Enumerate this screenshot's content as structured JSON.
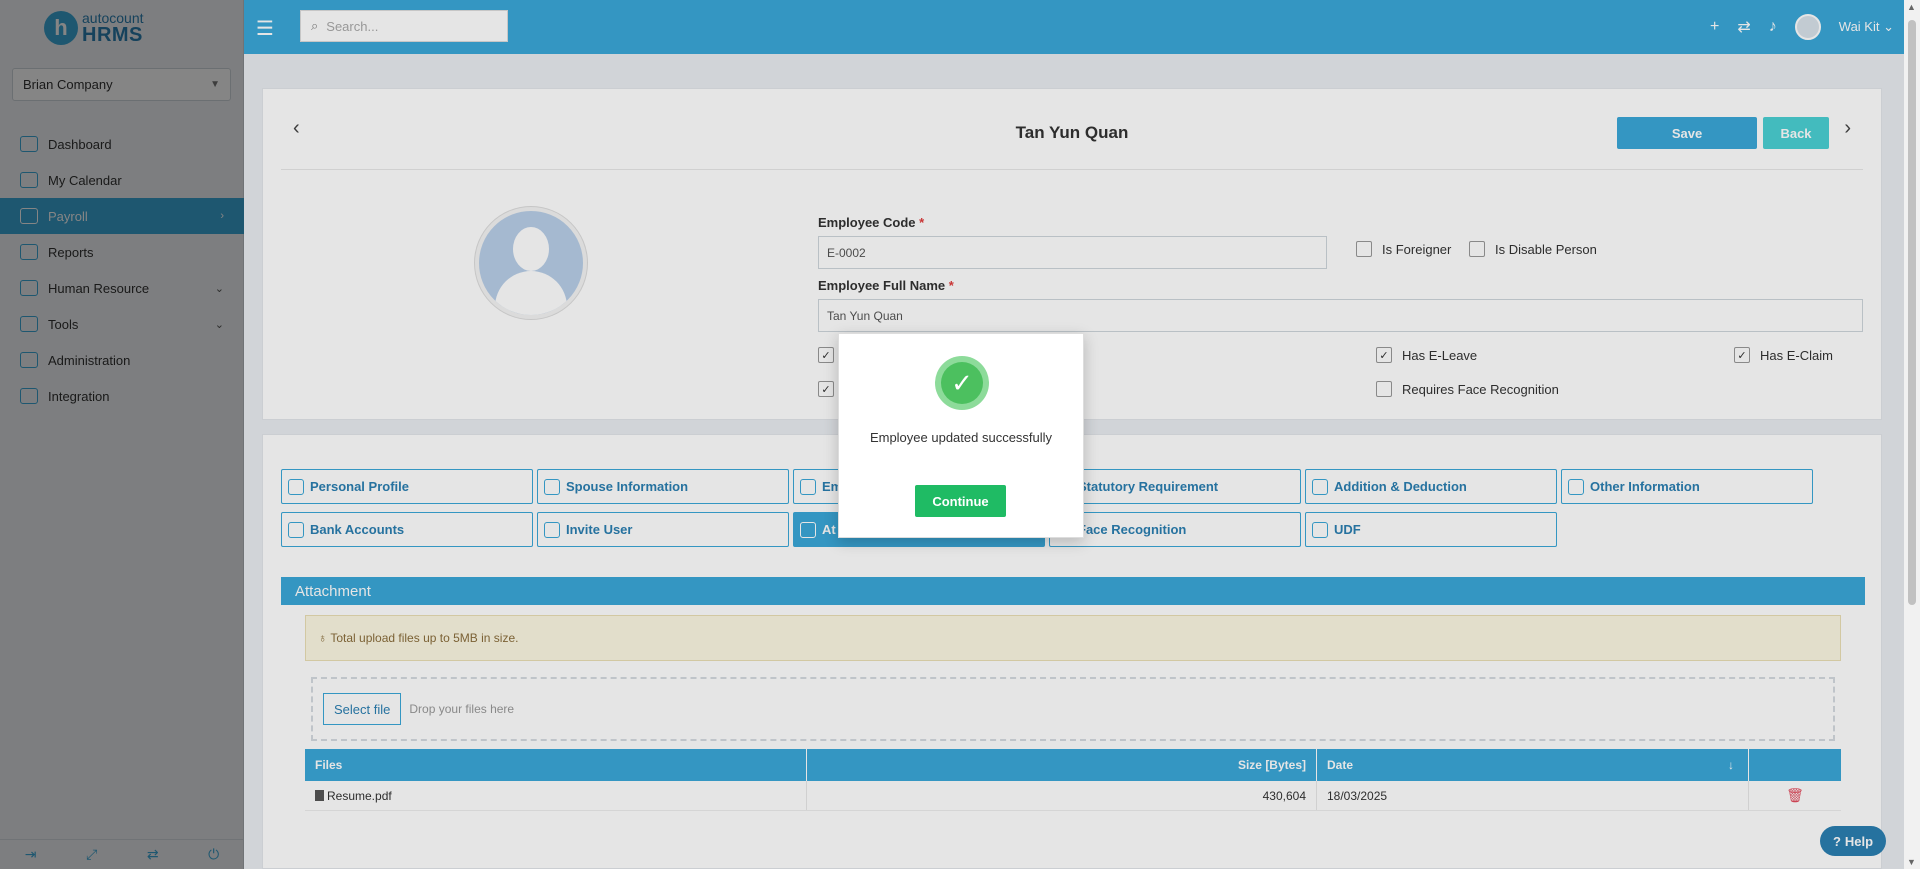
{
  "brand": {
    "logo_letter": "h",
    "logo_top": "autocount",
    "logo_bottom": "HRMS"
  },
  "company": {
    "selected": "Brian Company"
  },
  "sidebar": {
    "items": [
      {
        "label": "Dashboard",
        "icon": "dashboard-icon"
      },
      {
        "label": "My Calendar",
        "icon": "calendar-icon"
      },
      {
        "label": "Payroll",
        "icon": "payroll-icon",
        "active": true,
        "arrow": "›"
      },
      {
        "label": "Reports",
        "icon": "reports-icon"
      },
      {
        "label": "Human Resource",
        "icon": "human-resource-icon",
        "arrow": "⌄"
      },
      {
        "label": "Tools",
        "icon": "tools-icon",
        "arrow": "⌄"
      },
      {
        "label": "Administration",
        "icon": "administration-icon"
      },
      {
        "label": "Integration",
        "icon": "integration-icon"
      }
    ]
  },
  "topbar": {
    "search_placeholder": "Search...",
    "user_name": "Wai Kit"
  },
  "employee": {
    "title": "Tan Yun Quan",
    "save_label": "Save",
    "back_label": "Back",
    "code_label": "Employee Code",
    "code_value": "E-0002",
    "fullname_label": "Employee Full Name",
    "fullname_value": "Tan Yun Quan",
    "required_mark": "*",
    "is_foreigner": "Is Foreigner",
    "is_disable": "Is Disable Person",
    "has_eleave": "Has E-Leave",
    "has_eclaim": "Has E-Claim",
    "requires_face": "Requires Face Recognition"
  },
  "tabs": {
    "personal_profile": "Personal Profile",
    "spouse_information": "Spouse Information",
    "employment_partial": "Em",
    "statutory_requirement": "Statutory Requirement",
    "addition_deduction": "Addition & Deduction",
    "other_information": "Other Information",
    "bank_accounts": "Bank Accounts",
    "invite_user": "Invite User",
    "attachment_partial": "At",
    "face_recognition": "Face Recognition",
    "udf": "UDF"
  },
  "attachment": {
    "header": "Attachment",
    "info": "Total upload files up to 5MB in size.",
    "select_file": "Select file",
    "drop_text": "Drop your files here",
    "columns": {
      "files": "Files",
      "size": "Size [Bytes]",
      "date": "Date"
    },
    "rows": [
      {
        "file": "Resume.pdf",
        "size": "430,604",
        "date": "18/03/2025"
      }
    ]
  },
  "modal": {
    "message": "Employee updated successfully",
    "continue_label": "Continue"
  },
  "help": {
    "label": "Help"
  },
  "colors": {
    "primary": "#3aa7d8",
    "success": "#1fbb64",
    "back": "#4bd1d4",
    "danger": "#e34b5d"
  }
}
